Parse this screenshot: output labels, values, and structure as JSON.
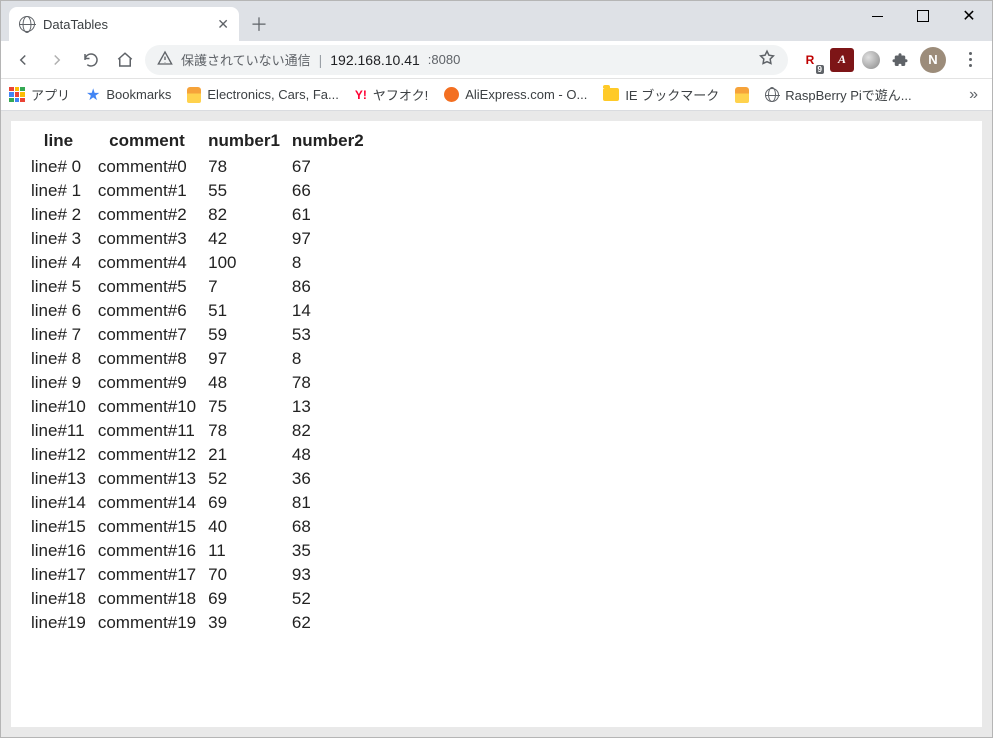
{
  "window": {
    "tab_title": "DataTables"
  },
  "toolbar": {
    "security_text": "保護されていない通信",
    "url_host": "192.168.10.41",
    "url_port": ":8080"
  },
  "bookmarks": {
    "apps": "アプリ",
    "bookmarks": "Bookmarks",
    "ecf": "Electronics, Cars, Fa...",
    "yahoo": "ヤフオク!",
    "ali": "AliExpress.com - O...",
    "ie": "IE ブックマーク",
    "rasp": "RaspBerry Piで遊ん..."
  },
  "ext": {
    "avatar_initial": "N",
    "rakuten_badge": "9"
  },
  "table": {
    "headers": {
      "line": "line",
      "comment": "comment",
      "number1": "number1",
      "number2": "number2"
    },
    "rows": [
      {
        "line": "line# 0",
        "comment": "comment#0",
        "number1": "78",
        "number2": "67"
      },
      {
        "line": "line# 1",
        "comment": "comment#1",
        "number1": "55",
        "number2": "66"
      },
      {
        "line": "line# 2",
        "comment": "comment#2",
        "number1": "82",
        "number2": "61"
      },
      {
        "line": "line# 3",
        "comment": "comment#3",
        "number1": "42",
        "number2": "97"
      },
      {
        "line": "line# 4",
        "comment": "comment#4",
        "number1": "100",
        "number2": "8"
      },
      {
        "line": "line# 5",
        "comment": "comment#5",
        "number1": "7",
        "number2": "86"
      },
      {
        "line": "line# 6",
        "comment": "comment#6",
        "number1": "51",
        "number2": "14"
      },
      {
        "line": "line# 7",
        "comment": "comment#7",
        "number1": "59",
        "number2": "53"
      },
      {
        "line": "line# 8",
        "comment": "comment#8",
        "number1": "97",
        "number2": "8"
      },
      {
        "line": "line# 9",
        "comment": "comment#9",
        "number1": "48",
        "number2": "78"
      },
      {
        "line": "line#10",
        "comment": "comment#10",
        "number1": "75",
        "number2": "13"
      },
      {
        "line": "line#11",
        "comment": "comment#11",
        "number1": "78",
        "number2": "82"
      },
      {
        "line": "line#12",
        "comment": "comment#12",
        "number1": "21",
        "number2": "48"
      },
      {
        "line": "line#13",
        "comment": "comment#13",
        "number1": "52",
        "number2": "36"
      },
      {
        "line": "line#14",
        "comment": "comment#14",
        "number1": "69",
        "number2": "81"
      },
      {
        "line": "line#15",
        "comment": "comment#15",
        "number1": "40",
        "number2": "68"
      },
      {
        "line": "line#16",
        "comment": "comment#16",
        "number1": "11",
        "number2": "35"
      },
      {
        "line": "line#17",
        "comment": "comment#17",
        "number1": "70",
        "number2": "93"
      },
      {
        "line": "line#18",
        "comment": "comment#18",
        "number1": "69",
        "number2": "52"
      },
      {
        "line": "line#19",
        "comment": "comment#19",
        "number1": "39",
        "number2": "62"
      }
    ]
  }
}
